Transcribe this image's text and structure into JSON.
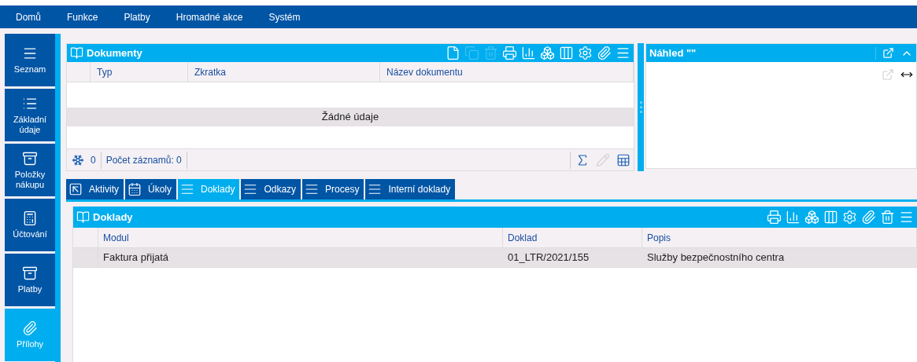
{
  "menu": [
    "Domů",
    "Funkce",
    "Platby",
    "Hromadné akce",
    "Systém"
  ],
  "sidebar": {
    "items": [
      {
        "label": "Seznam",
        "kind": "menu",
        "selected": false
      },
      {
        "label": "Základní údaje",
        "kind": "list",
        "selected": false
      },
      {
        "label": "Položky nákupu",
        "kind": "archive",
        "selected": false
      },
      {
        "label": "Účtování",
        "kind": "calculator",
        "selected": false
      },
      {
        "label": "Platby",
        "kind": "archive",
        "selected": false
      },
      {
        "label": "Přílohy",
        "kind": "attach",
        "selected": true
      }
    ]
  },
  "documents": {
    "title": "Dokumenty",
    "toolbar": [
      {
        "kind": "new",
        "disabled": false
      },
      {
        "kind": "copy",
        "disabled": true
      },
      {
        "kind": "delete",
        "disabled": true
      },
      {
        "kind": "print",
        "disabled": false
      },
      {
        "kind": "chart",
        "disabled": false
      },
      {
        "kind": "cubes",
        "disabled": false
      },
      {
        "kind": "columns",
        "disabled": false
      },
      {
        "kind": "settings",
        "disabled": false
      },
      {
        "kind": "attach",
        "disabled": false
      },
      {
        "kind": "menu",
        "disabled": false
      }
    ],
    "columns": [
      "Typ",
      "Zkratka",
      "Název dokumentu"
    ],
    "empty_message": "Žádné údaje",
    "footer": {
      "frozen_count": "0",
      "record_count": "Počet záznamů: 0",
      "tools": [
        {
          "kind": "sum",
          "disabled": false
        },
        {
          "kind": "edit",
          "disabled": true
        },
        {
          "kind": "export",
          "disabled": false
        }
      ]
    }
  },
  "preview": {
    "title": "Náhled \"\"",
    "tools": [
      {
        "kind": "popout",
        "disabled": true
      },
      {
        "kind": "fit-width",
        "disabled": false
      }
    ]
  },
  "tabs": [
    {
      "label": "Aktivity",
      "kind": "expand",
      "selected": false
    },
    {
      "label": "Úkoly",
      "kind": "calendar",
      "selected": false
    },
    {
      "label": "Doklady",
      "kind": "lines",
      "selected": true
    },
    {
      "label": "Odkazy",
      "kind": "lines",
      "selected": false
    },
    {
      "label": "Procesy",
      "kind": "lines",
      "selected": false
    },
    {
      "label": "Interní doklady",
      "kind": "lines",
      "selected": false
    }
  ],
  "receipts": {
    "title": "Doklady",
    "toolbar": [
      {
        "kind": "print",
        "disabled": false
      },
      {
        "kind": "chart",
        "disabled": false
      },
      {
        "kind": "cubes",
        "disabled": false
      },
      {
        "kind": "columns",
        "disabled": false
      },
      {
        "kind": "settings",
        "disabled": false
      },
      {
        "kind": "attach",
        "disabled": false
      },
      {
        "kind": "delete",
        "disabled": false
      },
      {
        "kind": "menu",
        "disabled": false
      }
    ],
    "columns": [
      "Modul",
      "Doklad",
      "Popis"
    ],
    "rows": [
      {
        "cells": [
          "Faktura přijatá",
          "01_LTR/2021/155",
          "Služby bezpečnostního centra"
        ],
        "selected": true
      }
    ]
  }
}
